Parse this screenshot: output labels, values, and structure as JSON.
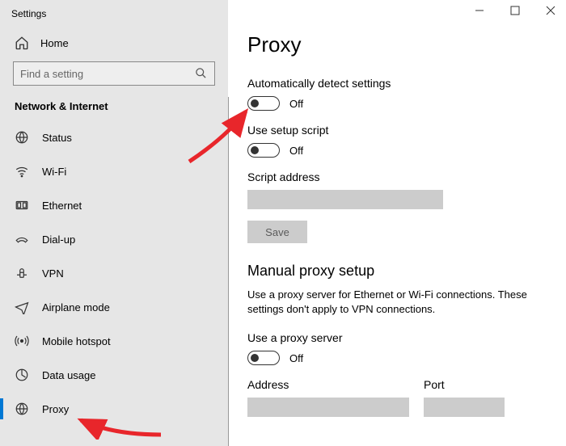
{
  "app": {
    "title": "Settings"
  },
  "window_buttons": {
    "min": "−",
    "max": "☐",
    "close": "✕"
  },
  "home_label": "Home",
  "search": {
    "placeholder": "Find a setting"
  },
  "section": "Network & Internet",
  "nav": [
    {
      "icon": "status",
      "label": "Status"
    },
    {
      "icon": "wifi",
      "label": "Wi-Fi"
    },
    {
      "icon": "ethernet",
      "label": "Ethernet"
    },
    {
      "icon": "dialup",
      "label": "Dial-up"
    },
    {
      "icon": "vpn",
      "label": "VPN"
    },
    {
      "icon": "airplane",
      "label": "Airplane mode"
    },
    {
      "icon": "hotspot",
      "label": "Mobile hotspot"
    },
    {
      "icon": "data",
      "label": "Data usage"
    },
    {
      "icon": "proxy",
      "label": "Proxy"
    }
  ],
  "page": {
    "title": "Proxy",
    "auto_detect": {
      "label": "Automatically detect settings",
      "state": "Off"
    },
    "setup_script": {
      "label": "Use setup script",
      "state": "Off"
    },
    "script_address": {
      "label": "Script address",
      "value": ""
    },
    "save_label": "Save",
    "manual": {
      "title": "Manual proxy setup",
      "desc": "Use a proxy server for Ethernet or Wi-Fi connections. These settings don't apply to VPN connections.",
      "use_proxy": {
        "label": "Use a proxy server",
        "state": "Off"
      },
      "address_label": "Address",
      "port_label": "Port"
    }
  }
}
